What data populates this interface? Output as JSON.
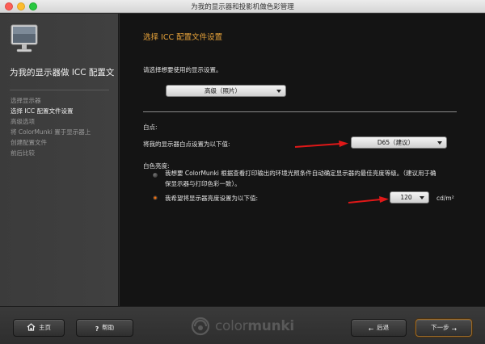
{
  "window": {
    "title": "为我的显示器和投影机做色彩管理"
  },
  "sidebar": {
    "title": "为我的显示器做 ICC 配置文",
    "steps": [
      {
        "label": "选择显示器",
        "active": false
      },
      {
        "label": "选择 ICC 配置文件设置",
        "active": true
      },
      {
        "label": "高级选项",
        "active": false
      },
      {
        "label": "将 ColorMunki 置于显示器上",
        "active": false
      },
      {
        "label": "创建配置文件",
        "active": false
      },
      {
        "label": "前后比较",
        "active": false
      }
    ]
  },
  "main": {
    "title": "选择 ICC 配置文件设置",
    "prompt": "请选择想要使用的显示设置。",
    "display_setting": {
      "value": "高级（照片）"
    },
    "whitepoint": {
      "heading": "白点:",
      "label": "将我的显示器白点设置为以下值:",
      "value": "D65（建议）"
    },
    "luminance": {
      "heading": "白色亮度:",
      "option_auto_line1": "我想要 ColorMunki 根据查看打印输出的环境光照条件自动确定显示器的最佳亮度等级。（建议用于确",
      "option_auto_line2": "保显示器与打印色彩一致）。",
      "option_manual": "我希望将显示器亮度设置为以下值:",
      "value": "120",
      "unit": "cd/m²",
      "selected": "manual"
    }
  },
  "footer": {
    "home_label": "主页",
    "help_label": "帮助",
    "brand": "colormunki",
    "brand_plain": "color",
    "brand_bold": "munki",
    "back_label": "后退",
    "next_label": "下一步"
  },
  "colors": {
    "accent": "#e8a33a",
    "annotation_arrow": "#e01818",
    "radio_selected": "#e06a10"
  },
  "icons": [
    "monitor-icon",
    "home-icon",
    "help-icon",
    "back-arrow-icon",
    "next-arrow-icon",
    "colormunki-logo"
  ]
}
